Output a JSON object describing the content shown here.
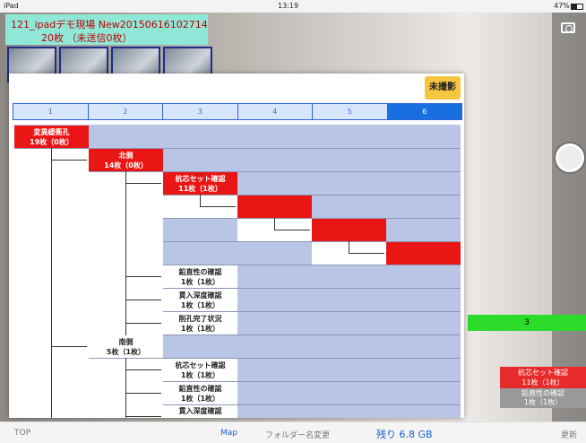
{
  "status_bar": {
    "carrier": "iPad",
    "time": "13:19",
    "battery": "47%"
  },
  "header": {
    "site_title": "121_ipadデモ現場 New20150616102714",
    "photo_count": "20枚 （未送信0枚）"
  },
  "panel": {
    "unshot_button": "未撮影",
    "tabs": [
      "1",
      "2",
      "3",
      "4",
      "5",
      "6"
    ],
    "active_tab_index": 6,
    "nodes": [
      {
        "title": "変異緩衝孔",
        "count": "19枚（0枚）"
      },
      {
        "title": "北側",
        "count": "14枚（0枚）"
      },
      {
        "title": "杭芯セット確認",
        "count": "11枚（1枚）"
      },
      {
        "title": "鉛直性の確認",
        "count": "1枚（1枚）"
      },
      {
        "title": "貫入深度確認",
        "count": "1枚（1枚）"
      },
      {
        "title": "削孔完了状況",
        "count": "1枚（1枚）"
      },
      {
        "title": "南側",
        "count": "5枚（1枚）"
      },
      {
        "title": "杭芯セット確認",
        "count": "1枚（1枚）"
      },
      {
        "title": "鉛直性の確認",
        "count": "1枚（1枚）"
      },
      {
        "title": "貫入深度確認",
        "count": ""
      }
    ]
  },
  "background_overlay": {
    "green_label": "3",
    "red_title": "杭芯セット確認",
    "red_count": "11枚（1枚）",
    "gray_title": "鉛直性の確認",
    "gray_count": "1枚（1枚）"
  },
  "bottom_bar": {
    "top": "TOP",
    "map": "Map",
    "rename": "フォルダー名変更",
    "remaining": "残り 6.8 GB",
    "update": "更新"
  },
  "colors": {
    "accent_blue": "#1a6fe0",
    "node_red": "#ea1616",
    "header_teal": "#8fe7d8",
    "unshot_yellow": "#f5c542",
    "tree_bg": "#b9c5e4"
  }
}
